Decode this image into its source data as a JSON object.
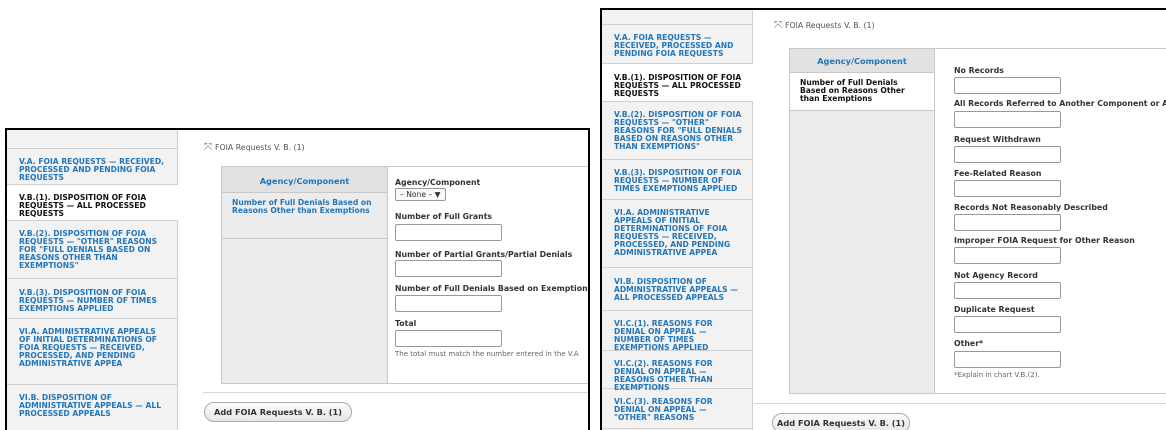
{
  "vtabs_left": [
    "V.A. FOIA REQUESTS — RECEIVED, PROCESSED AND PENDING FOIA REQUESTS",
    "V.B.(1). DISPOSITION OF FOIA REQUESTS — ALL PROCESSED REQUESTS",
    "V.B.(2). DISPOSITION OF FOIA REQUESTS — \"OTHER\" REASONS FOR \"FULL DENIALS BASED ON REASONS OTHER THAN EXEMPTIONS\"",
    "V.B.(3). DISPOSITION OF FOIA REQUESTS — NUMBER OF TIMES EXEMPTIONS APPLIED",
    "VI.A. ADMINISTRATIVE APPEALS OF INITIAL DETERMINATIONS OF FOIA REQUESTS — RECEIVED, PROCESSED, AND PENDING ADMINISTRATIVE APPEA",
    "VI.B. DISPOSITION OF ADMINISTRATIVE APPEALS — ALL PROCESSED APPEALS"
  ],
  "vtabs_right": [
    "V.A. FOIA REQUESTS — RECEIVED, PROCESSED AND PENDING FOIA REQUESTS",
    "V.B.(1). DISPOSITION OF FOIA REQUESTS — ALL PROCESSED REQUESTS",
    "V.B.(2). DISPOSITION OF FOIA REQUESTS — \"OTHER\" REASONS FOR \"FULL DENIALS BASED ON REASONS OTHER THAN EXEMPTIONS\"",
    "V.B.(3). DISPOSITION OF FOIA REQUESTS — NUMBER OF TIMES EXEMPTIONS APPLIED",
    "VI.A. ADMINISTRATIVE APPEALS OF INITIAL DETERMINATIONS OF FOIA REQUESTS — RECEIVED, PROCESSED, AND PENDING ADMINISTRATIVE APPEA",
    "VI.B. DISPOSITION OF ADMINISTRATIVE APPEALS — ALL PROCESSED APPEALS",
    "VI.C.(1). REASONS FOR DENIAL ON APPEAL — NUMBER OF TIMES EXEMPTIONS APPLIED",
    "VI.C.(2). REASONS FOR DENIAL ON APPEAL — REASONS OTHER THAN EXEMPTIONS",
    "VI.C.(3). REASONS FOR DENIAL ON APPEAL — \"OTHER\" REASONS"
  ],
  "fieldset_label": "FOIA Requests V. B. (1)",
  "move_icon": "⤧",
  "inner_tab_header": "Agency/Component",
  "inner_tab_item": "Number of Full Denials Based on Reasons Other than Exemptions",
  "left_fields": {
    "agency_label": "Agency/Component",
    "agency_select": "– None – ▼",
    "full_grants": "Number of Full Grants",
    "partial_grants": "Number of Partial Grants/Partial Denials",
    "full_denials": "Number of Full Denials Based on Exemptions",
    "total": "Total",
    "total_desc": "The total must match the number entered in the V.A"
  },
  "right_fields": {
    "no_records": "No Records",
    "referred": "All Records Referred to Another Component or Agency",
    "withdrawn": "Request Withdrawn",
    "fee": "Fee-Related Reason",
    "not_described": "Records Not Reasonably Described",
    "improper": "Improper FOIA Request for Other Reason",
    "not_agency": "Not Agency Record",
    "duplicate": "Duplicate Request",
    "other": "Other*",
    "other_desc": "*Explain in chart V.B.(2)."
  },
  "add_button": "Add FOIA Requests V. B. (1)"
}
